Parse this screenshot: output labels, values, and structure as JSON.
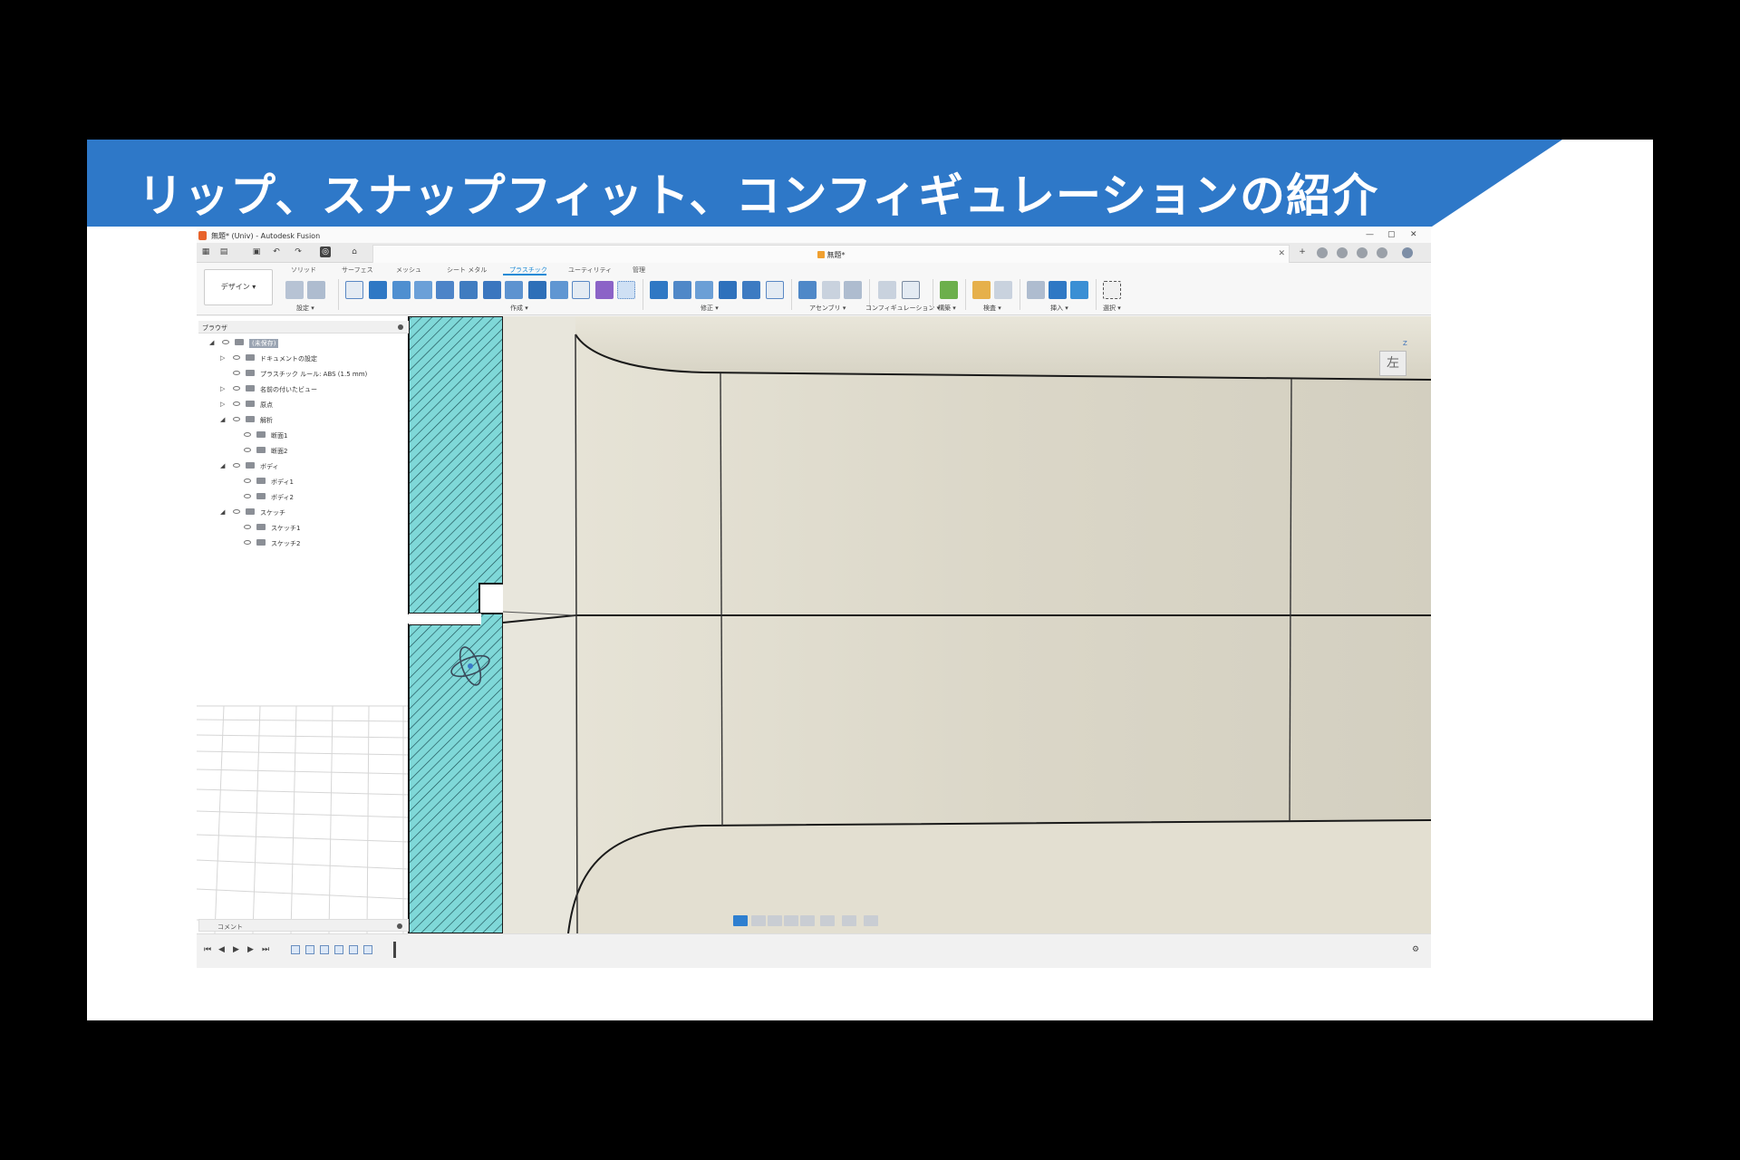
{
  "slide": {
    "title": "リップ、スナップフィット、コンフィギュレーションの紹介",
    "banner_color": "#2e78c8"
  },
  "window": {
    "title": "無題* (Univ) - Autodesk Fusion",
    "doc_tab": "無題*",
    "controls": [
      "—",
      "▢",
      "✕"
    ]
  },
  "toolbar": {
    "workspace": "デザイン ▾",
    "tabs": [
      "ソリッド",
      "サーフェス",
      "メッシュ",
      "シート メタル",
      "プラスチック",
      "ユーティリティ",
      "管理"
    ],
    "active_tab": "プラスチック",
    "groups": [
      "設定 ▾",
      "作成 ▾",
      "修正 ▾",
      "アセンブリ ▾",
      "コンフィギュレーション ▾",
      "構築 ▾",
      "検査 ▾",
      "挿入 ▾",
      "選択 ▾"
    ]
  },
  "browser": {
    "header": "ブラウザ",
    "nodes": [
      {
        "label": "(未保存)",
        "level": 0
      },
      {
        "label": "ドキュメントの設定",
        "level": 1
      },
      {
        "label": "プラスチック ルール: ABS (1.5 mm)",
        "level": 1
      },
      {
        "label": "名前の付いたビュー",
        "level": 1
      },
      {
        "label": "原点",
        "level": 1
      },
      {
        "label": "解析",
        "level": 1
      },
      {
        "label": "断面1",
        "level": 2
      },
      {
        "label": "断面2",
        "level": 2
      },
      {
        "label": "ボディ",
        "level": 1
      },
      {
        "label": "ボディ1",
        "level": 2
      },
      {
        "label": "ボディ2",
        "level": 2
      },
      {
        "label": "スケッチ",
        "level": 1
      },
      {
        "label": "スケッチ1",
        "level": 2
      },
      {
        "label": "スケッチ2",
        "level": 2
      }
    ]
  },
  "comment_panel": "コメント",
  "viewcube": {
    "face": "左",
    "axis": "Z"
  },
  "colors": {
    "section_hatch": "#7fd8d8",
    "model_surface": "#dcd8c9",
    "accent": "#1b8ad6"
  }
}
